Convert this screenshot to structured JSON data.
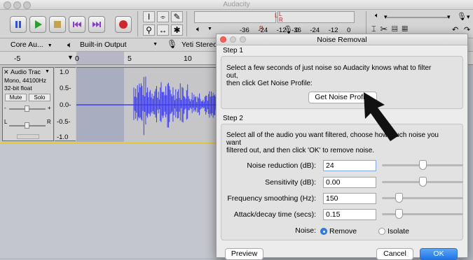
{
  "app": {
    "title": "Audacity"
  },
  "transport": {
    "buttons": [
      "pause",
      "play",
      "stop",
      "skip-start",
      "skip-end",
      "record"
    ]
  },
  "meters": {
    "scale1": [
      "-36",
      "-24",
      "-12",
      "0"
    ],
    "scale2": [
      "-36",
      "-24",
      "-12",
      "0"
    ],
    "channel_left": "L",
    "channel_right": "R"
  },
  "devices": {
    "host": "Core Au...",
    "output": "Built-in Output",
    "input": "Yeti Stereo"
  },
  "ruler": {
    "ticks": [
      "-5",
      "0",
      "5",
      "10"
    ]
  },
  "track": {
    "name": "Audio Trac",
    "info1": "Mono, 44100Hz",
    "info2": "32-bit float",
    "mute": "Mute",
    "solo": "Solo",
    "gain_minus": "-",
    "gain_plus": "+",
    "pan_l": "L",
    "pan_r": "R",
    "scale": [
      "1.0",
      "0.5-",
      "0.0-",
      "-0.5-",
      "-1.0"
    ]
  },
  "dialog": {
    "title": "Noise Removal",
    "step1_title": "Step 1",
    "step1_line1": "Select a few seconds of just noise so Audacity knows what to filter",
    "step1_line2": "out,",
    "step1_line3": "then click Get Noise Profile:",
    "get_profile_button": "Get Noise Profile",
    "step2_title": "Step 2",
    "step2_line1": "Select all of the audio you want filtered, choose how much noise you",
    "step2_line2": "want",
    "step2_line3": "filtered out, and then click 'OK' to remove noise.",
    "params": [
      {
        "label": "Noise reduction (dB):",
        "value": "24",
        "level": 0.5
      },
      {
        "label": "Sensitivity (dB):",
        "value": "0.00",
        "level": 0.5
      },
      {
        "label": "Frequency smoothing (Hz):",
        "value": "150",
        "level": 0.18
      },
      {
        "label": "Attack/decay time (secs):",
        "value": "0.15",
        "level": 0.18
      }
    ],
    "noise_label": "Noise:",
    "noise_options": [
      {
        "label": "Remove",
        "selected": true
      },
      {
        "label": "Isolate",
        "selected": false
      }
    ],
    "preview_button": "Preview",
    "cancel_button": "Cancel",
    "ok_button": "OK"
  },
  "colors": {
    "accent": "#2f7de1",
    "wave": "#3c3cf0",
    "selection": "#a8aec0",
    "track_yellow": "#e1c83e"
  }
}
